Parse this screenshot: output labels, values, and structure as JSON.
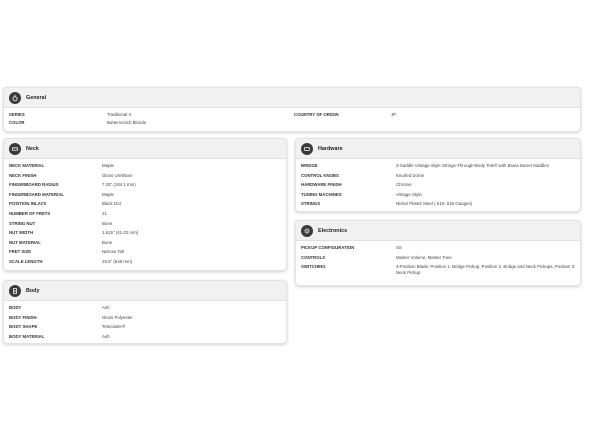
{
  "general": {
    "title": "General",
    "icon": "guitar-icon",
    "series_label": "SERIES",
    "series_value": "Traditional II",
    "color_label": "COLOR",
    "color_value": "Butterscotch Blonde",
    "origin_label": "COUNTRY OF ORIGIN",
    "origin_value": "JP"
  },
  "neck": {
    "title": "Neck",
    "icon": "neck-icon",
    "rows": [
      {
        "label": "NECK MATERIAL",
        "value": "Maple"
      },
      {
        "label": "NECK FINISH",
        "value": "Gloss Urethane"
      },
      {
        "label": "FINGERBOARD RADIUS",
        "value": "7.25\" (184.1 mm)"
      },
      {
        "label": "FINGERBOARD MATERIAL",
        "value": "Maple"
      },
      {
        "label": "POSITION INLAYS",
        "value": "Black Dot"
      },
      {
        "label": "NUMBER OF FRETS",
        "value": "21"
      },
      {
        "label": "STRING NUT",
        "value": "Bone"
      },
      {
        "label": "NUT WIDTH",
        "value": "1.615\" (41.02 mm)"
      },
      {
        "label": "NUT MATERIAL",
        "value": "Bone"
      },
      {
        "label": "FRET SIZE",
        "value": "Narrow Tall"
      },
      {
        "label": "SCALE LENGTH",
        "value": "25.5\" (648 mm)"
      }
    ]
  },
  "body_section": {
    "title": "Body",
    "icon": "body-icon",
    "rows": [
      {
        "label": "BODY",
        "value": "Ash"
      },
      {
        "label": "BODY FINISH",
        "value": "Gloss Polyester"
      },
      {
        "label": "BODY SHAPE",
        "value": "Telecaster®"
      },
      {
        "label": "BODY MATERIAL",
        "value": "Ash"
      }
    ]
  },
  "hardware": {
    "title": "Hardware",
    "icon": "hardware-icon",
    "rows": [
      {
        "label": "BRIDGE",
        "value": "3-Saddle Vintage-Style Strings-Through-Body Tele® with Brass Barrel Saddles"
      },
      {
        "label": "CONTROL KNOBS",
        "value": "Knurled Dome"
      },
      {
        "label": "HARDWARE FINISH",
        "value": "Chrome"
      },
      {
        "label": "TUNING MACHINES",
        "value": "Vintage Style"
      },
      {
        "label": "STRINGS",
        "value": "Nickel Plated Steel (.010-.046 Gauges)"
      }
    ]
  },
  "electronics": {
    "title": "Electronics",
    "icon": "electronics-icon",
    "rows": [
      {
        "label": "PICKUP CONFIGURATION",
        "value": "SS"
      },
      {
        "label": "CONTROLS",
        "value": "Master Volume, Master Tone"
      },
      {
        "label": "SWITCHING",
        "value": "3-Position Blade: Position 1. Bridge Pickup, Position 2. Bridge and Neck Pickups, Position 3. Neck Pickup"
      }
    ]
  }
}
